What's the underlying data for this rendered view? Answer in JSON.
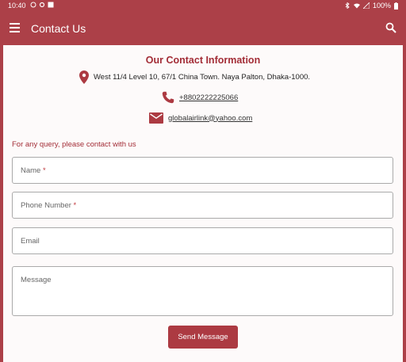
{
  "status_bar": {
    "time": "10:40",
    "battery": "100%"
  },
  "app_bar": {
    "title": "Contact Us",
    "menu_icon": "hamburger-menu-icon",
    "search_icon": "search-icon"
  },
  "contact_info": {
    "title": "Our Contact Information",
    "address": "West 11/4 Level 10, 67/1 China Town. Naya Palton, Dhaka-1000.",
    "phone": "+8802222225066",
    "email": "globalairlink@yahoo.com"
  },
  "form": {
    "intro": "For any query, please contact with us",
    "name_label": "Name",
    "phone_label": "Phone Number",
    "email_label": "Email",
    "message_label": "Message",
    "required_mark": "*",
    "submit_label": "Send Message"
  },
  "colors": {
    "brand": "#ac4048",
    "accent_text": "#a32d37"
  }
}
